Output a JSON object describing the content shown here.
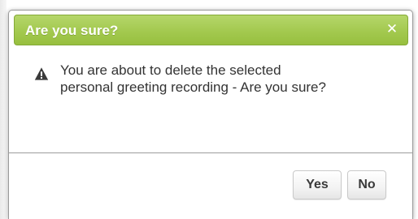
{
  "dialog": {
    "title": "Are you sure?",
    "close_icon": "close-icon",
    "message_line1": "You are about to delete the selected",
    "message_line2": "personal greeting recording - Are you sure?",
    "warning_icon": "warning-icon",
    "buttons": {
      "yes": "Yes",
      "no": "No"
    }
  },
  "colors": {
    "titlebar": "#a3c94f",
    "title_text": "#ffffff",
    "body_text": "#333333"
  }
}
